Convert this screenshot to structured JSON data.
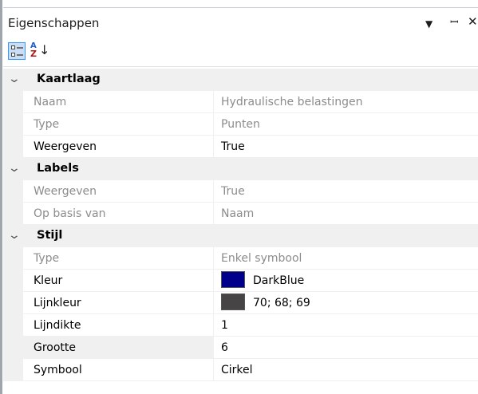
{
  "panel": {
    "title": "Eigenschappen",
    "controls": {
      "dropdown_icon": "dropdown-arrow-icon",
      "pin_icon": "pin-icon",
      "close_icon": "close-icon"
    }
  },
  "toolbar": {
    "categorized_icon": "categorized-view-icon",
    "alphabetical_icon": "sort-alphabetical-icon",
    "alpha_top": "A",
    "alpha_bottom": "Z",
    "alpha_arrow": "↓"
  },
  "categories": [
    {
      "label": "Kaartlaag",
      "properties": [
        {
          "name": "Naam",
          "value": "Hydraulische belastingen",
          "readonly": true
        },
        {
          "name": "Type",
          "value": "Punten",
          "readonly": true
        },
        {
          "name": "Weergeven",
          "value": "True",
          "readonly": false
        }
      ]
    },
    {
      "label": "Labels",
      "properties": [
        {
          "name": "Weergeven",
          "value": "True",
          "readonly": true
        },
        {
          "name": "Op basis van",
          "value": "Naam",
          "readonly": true
        }
      ]
    },
    {
      "label": "Stijl",
      "properties": [
        {
          "name": "Type",
          "value": "Enkel symbool",
          "readonly": true
        },
        {
          "name": "Kleur",
          "value": "DarkBlue",
          "readonly": false,
          "swatch": "#00008b"
        },
        {
          "name": "Lijnkleur",
          "value": "70; 68; 69",
          "readonly": false,
          "swatch": "#464445"
        },
        {
          "name": "Lijndikte",
          "value": "1",
          "readonly": false
        },
        {
          "name": "Grootte",
          "value": "6",
          "readonly": false,
          "selected": true
        },
        {
          "name": "Symbool",
          "value": "Cirkel",
          "readonly": false
        }
      ]
    }
  ],
  "colors": {
    "category_bg": "#f0f0f0",
    "readonly_text": "#8c8c8c",
    "toolbar_active": "#c9def5",
    "toolbar_active_border": "#3399ff"
  }
}
